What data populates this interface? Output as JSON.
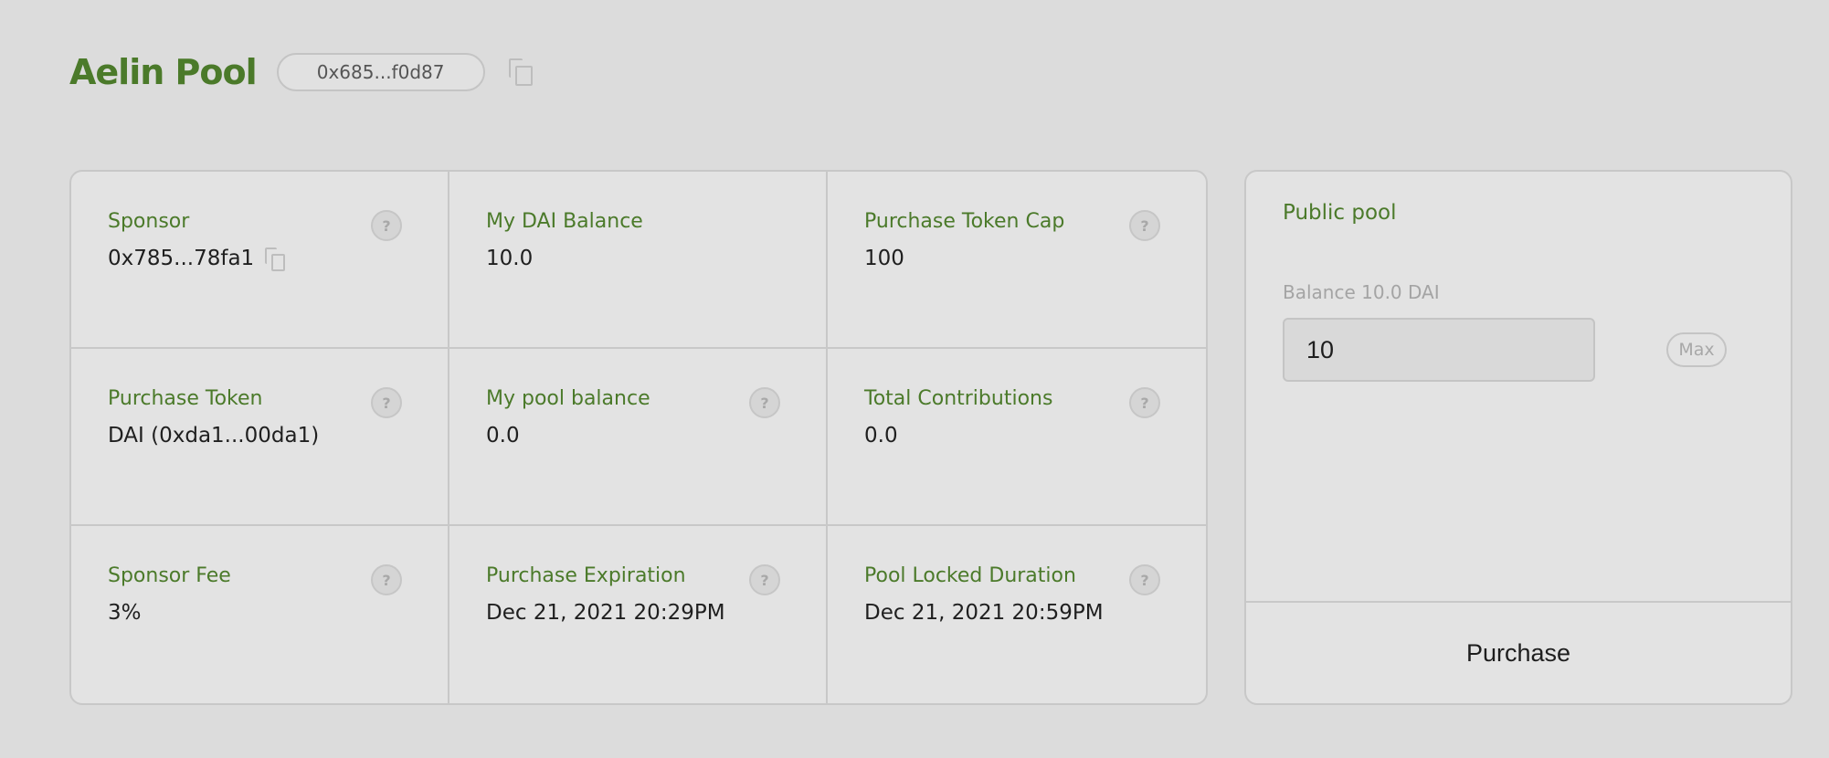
{
  "header": {
    "title": "Aelin Pool",
    "pool_address": "0x685...f0d87",
    "copy_icon": "copy-icon"
  },
  "stats": {
    "sponsor": {
      "label": "Sponsor",
      "value": "0x785...78fa1",
      "help_icon": "help-icon",
      "copy_icon": "copy-icon"
    },
    "my_dai_balance": {
      "label": "My DAI Balance",
      "value": "10.0"
    },
    "purchase_token_cap": {
      "label": "Purchase Token Cap",
      "value": "100",
      "help_icon": "help-icon"
    },
    "purchase_token": {
      "label": "Purchase Token",
      "value": "DAI (0xda1...00da1)",
      "help_icon": "help-icon"
    },
    "my_pool_balance": {
      "label": "My pool balance",
      "value": "0.0",
      "help_icon": "help-icon"
    },
    "total_contributions": {
      "label": "Total Contributions",
      "value": "0.0",
      "help_icon": "help-icon"
    },
    "sponsor_fee": {
      "label": "Sponsor Fee",
      "value": "3%",
      "help_icon": "help-icon"
    },
    "purchase_expiration": {
      "label": "Purchase Expiration",
      "value": "Dec 21, 2021 20:29PM",
      "help_icon": "help-icon"
    },
    "pool_locked_duration": {
      "label": "Pool Locked Duration",
      "value": "Dec 21, 2021 20:59PM",
      "help_icon": "help-icon"
    },
    "help_glyph": "?"
  },
  "purchase_panel": {
    "pool_type": "Public pool",
    "balance_label": "Balance 10.0 DAI",
    "amount_value": "10",
    "max_label": "Max",
    "purchase_label": "Purchase"
  },
  "colors": {
    "accent_green": "#4b7a2a",
    "background": "#dcdcdc",
    "card": "#e3e3e3",
    "border": "#c8c8c8"
  }
}
